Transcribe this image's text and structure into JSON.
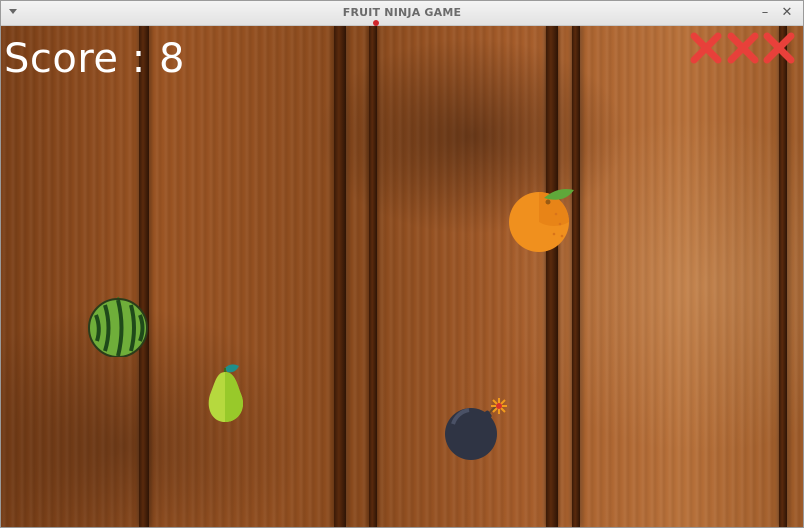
{
  "window": {
    "title": "FRUIT NINJA GAME",
    "minimize_glyph": "–",
    "close_glyph": "✕"
  },
  "hud": {
    "score_text": "Score : 8",
    "score_value": 8,
    "strikes": 3,
    "strike_color": "#e8403a"
  },
  "objects": [
    {
      "kind": "watermelon",
      "icon": "watermelon-icon"
    },
    {
      "kind": "pear",
      "icon": "pear-icon"
    },
    {
      "kind": "orange",
      "icon": "orange-icon"
    },
    {
      "kind": "bomb",
      "icon": "bomb-icon"
    }
  ],
  "colors": {
    "wood_dark": "#7a3f17",
    "wood_light": "#b8713a",
    "score_text": "#ffffff",
    "watermelon": "#2f7a2a",
    "pear": "#b6d93e",
    "orange": "#f0901e",
    "bomb": "#2f3444"
  }
}
